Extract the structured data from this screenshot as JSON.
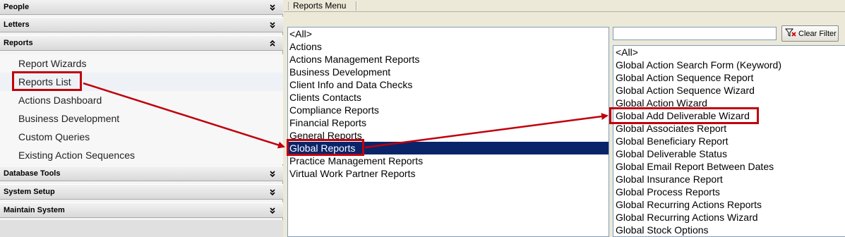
{
  "nav": {
    "sections": [
      {
        "label": "People",
        "state": "collapsed"
      },
      {
        "label": "Letters",
        "state": "collapsed"
      },
      {
        "label": "Reports",
        "state": "expanded"
      },
      {
        "label": "Database Tools",
        "state": "collapsed"
      },
      {
        "label": "System Setup",
        "state": "collapsed"
      },
      {
        "label": "Maintain System",
        "state": "collapsed"
      }
    ],
    "report_items": [
      "Report Wizards",
      "Reports List",
      "Actions Dashboard",
      "Business Development",
      "Custom Queries",
      "Existing Action Sequences"
    ]
  },
  "tabstrip": {
    "label": "Reports Menu"
  },
  "categories": {
    "items": [
      "<All>",
      "Actions",
      "Actions Management Reports",
      "Business Development",
      "Client Info and Data Checks",
      "Clients Contacts",
      "Compliance Reports",
      "Financial Reports",
      "General Reports",
      "Global Reports",
      "Practice Management Reports",
      "Virtual Work Partner Reports"
    ],
    "selected": "Global Reports"
  },
  "filter": {
    "value": "",
    "button_label": "Clear Filter"
  },
  "reports": {
    "items": [
      "<All>",
      "Global Action Search Form (Keyword)",
      "Global Action Sequence Report",
      "Global Action Sequence Wizard",
      "Global Action Wizard",
      "Global Add Deliverable Wizard",
      "Global Associates Report",
      "Global Beneficiary Report",
      "Global Deliverable Status",
      "Global Email Report Between Dates",
      "Global Insurance Report",
      "Global Process Reports",
      "Global Recurring Actions Reports",
      "Global Recurring Actions Wizard",
      "Global Stock Options"
    ]
  },
  "colors": {
    "selection": "#0a246a",
    "annotation": "#c0000c"
  }
}
